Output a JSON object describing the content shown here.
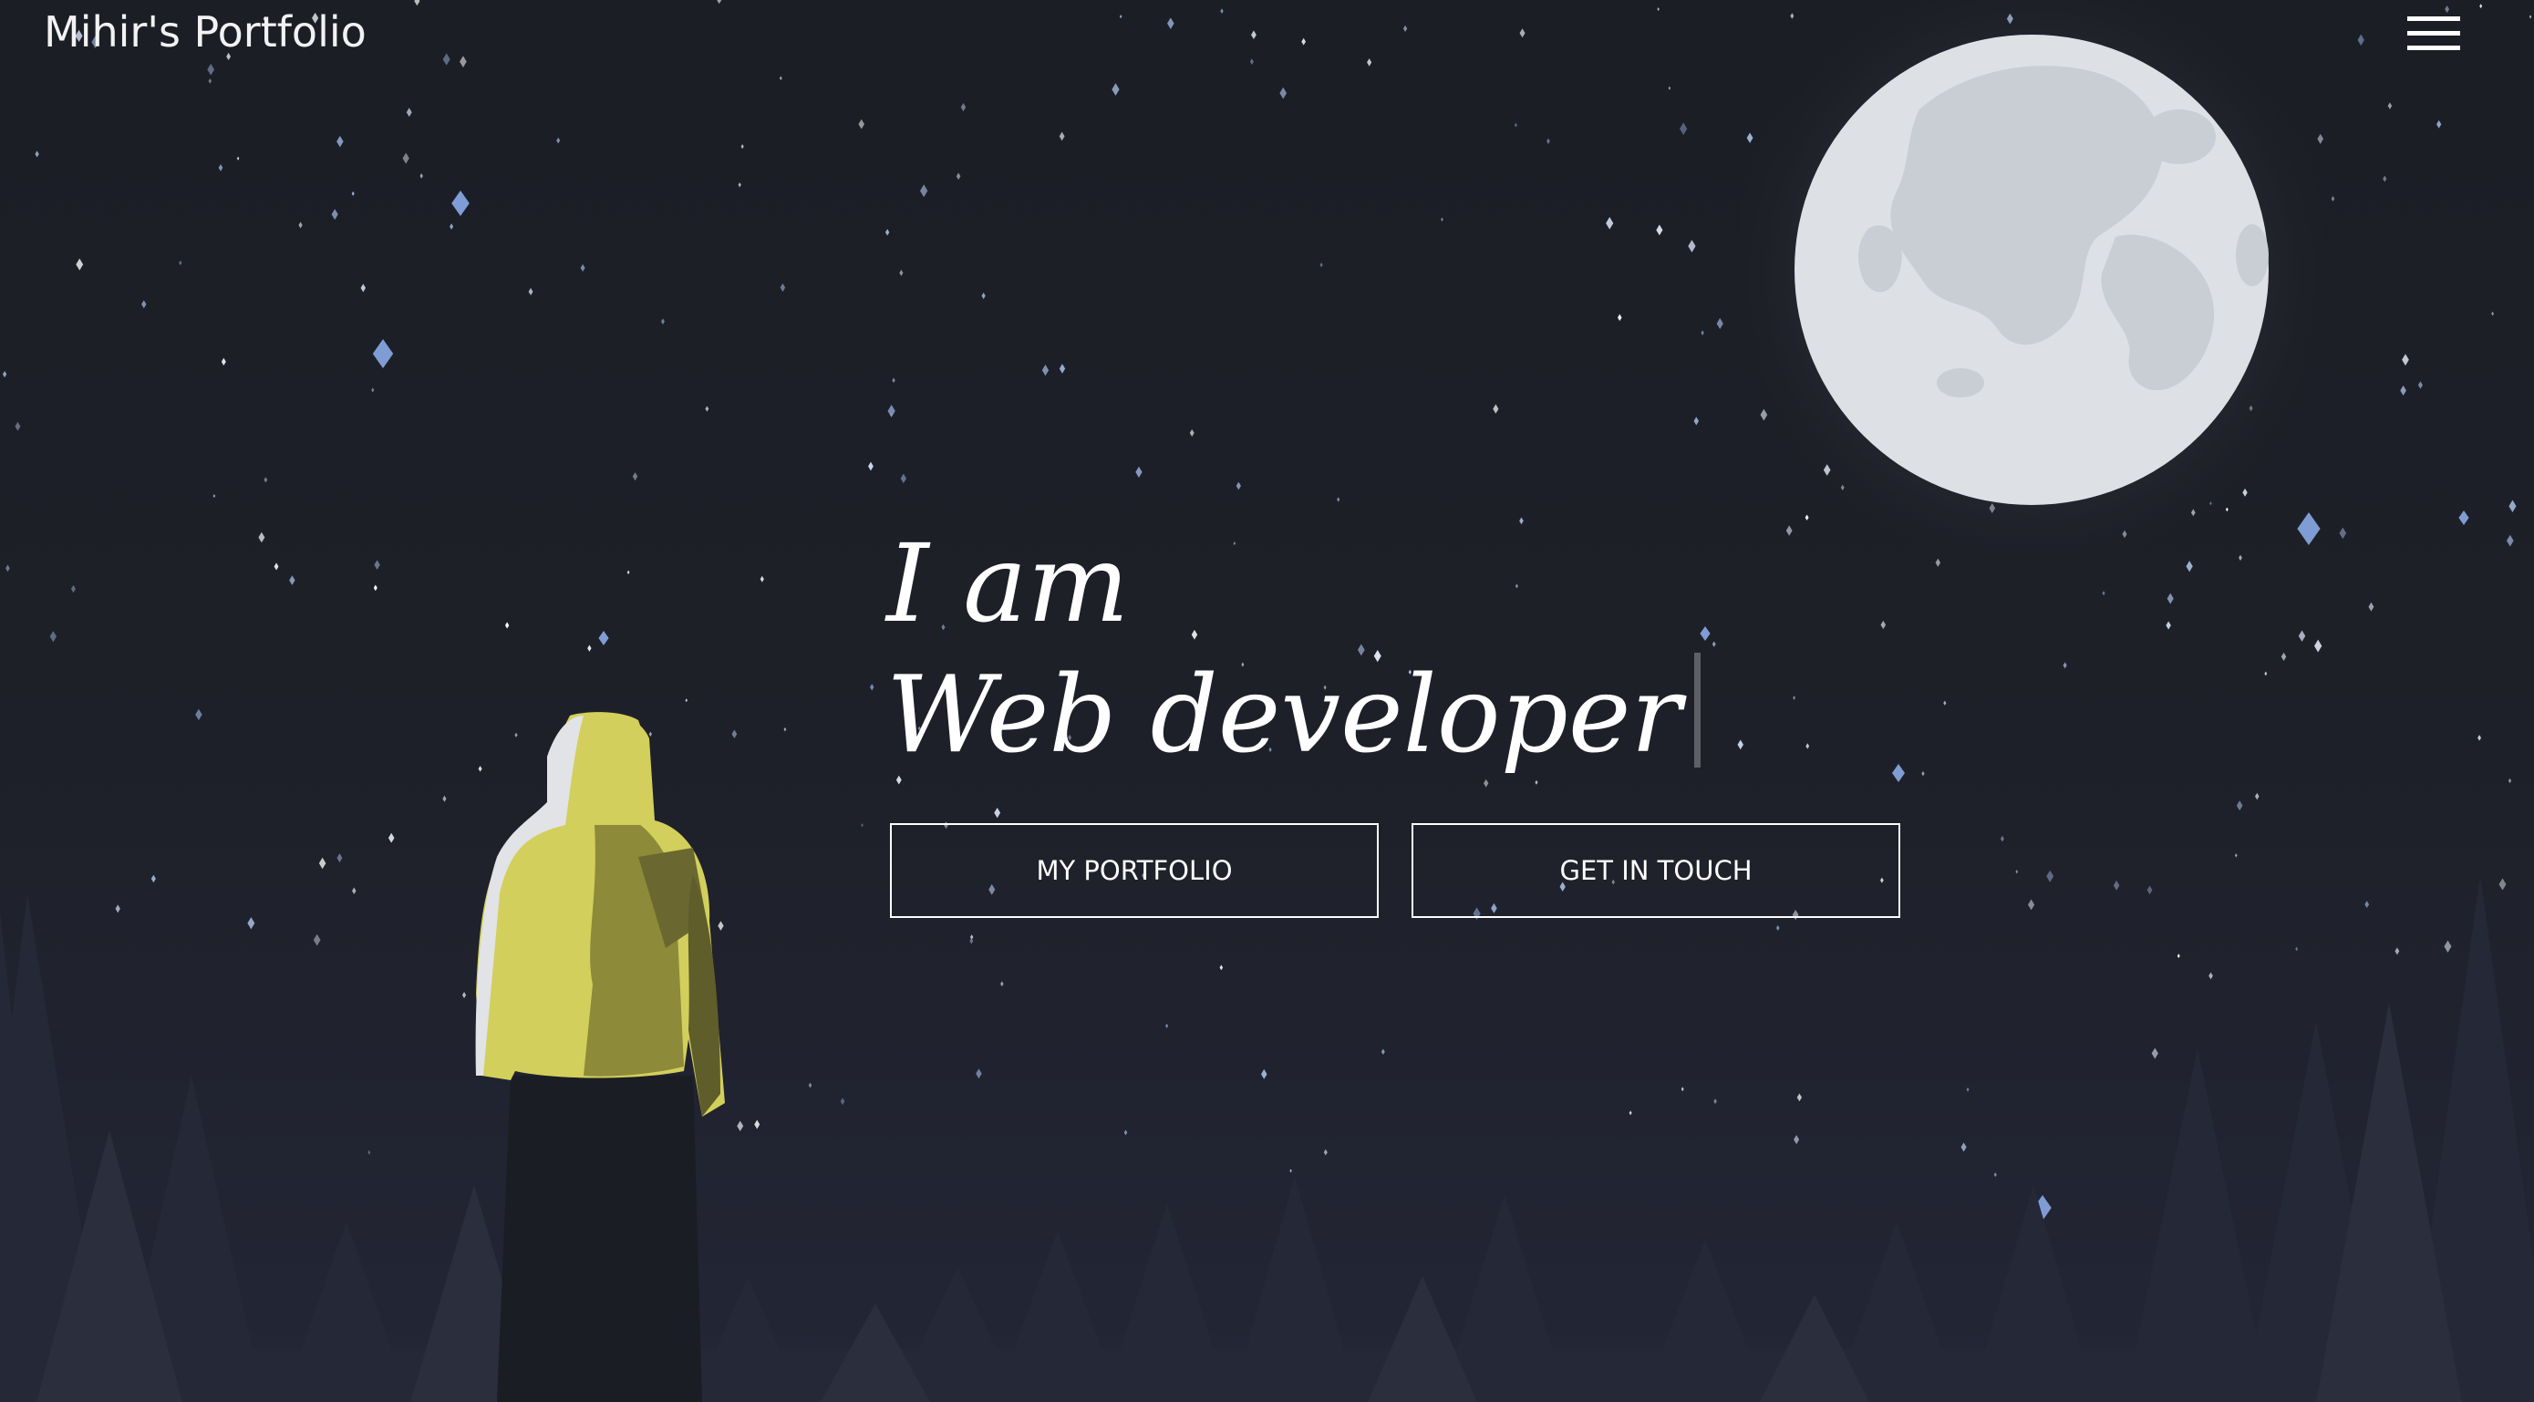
{
  "nav": {
    "brand": "Mihir's Portfolio",
    "menu_icon": "hamburger-menu-icon"
  },
  "hero": {
    "line1": "I am",
    "role": "Web developer",
    "primary_button": "MY PORTFOLIO",
    "secondary_button": "GET IN TOUCH"
  },
  "illustration": {
    "moon_icon": "full-moon",
    "figure_icon": "hooded-person-figure",
    "trees_icon": "pine-forest-silhouette",
    "stars_icon": "scattered-stars"
  },
  "colors": {
    "background": "#1d1f28",
    "text": "#ffffff",
    "moon": "#dfe2e7",
    "jacket": "#d2cf5c",
    "trees": "#262a38"
  }
}
